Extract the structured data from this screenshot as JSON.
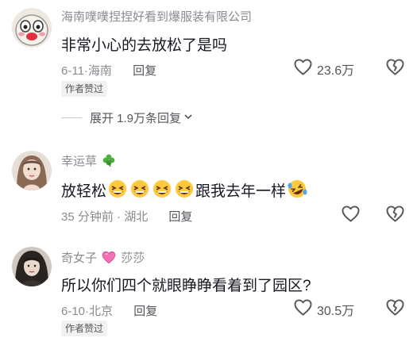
{
  "comments": [
    {
      "username": "海南噗噗捏捏好看到爆服装有限公司",
      "text": "非常小心的去放松了是吗",
      "date": "6-11",
      "location": "海南",
      "reply_label": "回复",
      "likes": "23.6万",
      "badge": "作者赞过",
      "expand_label": "展开 1.9万条回复"
    },
    {
      "username": "幸运草",
      "text_prefix": "放轻松",
      "text_suffix": "跟我去年一样",
      "date": "35 分钟前",
      "location": "湖北",
      "reply_label": "回复"
    },
    {
      "username": "奇女子",
      "username_suffix": "莎莎",
      "text": "所以你们四个就眼睁睁看着到了园区?",
      "date": "6-10",
      "location": "北京",
      "reply_label": "回复",
      "likes": "30.5万",
      "badge": "作者赞过"
    }
  ],
  "icons": {
    "clover": "four-leaf-clover-icon",
    "heart": "heart-outline-icon",
    "broken_heart": "broken-heart-icon",
    "pink_heart": "pink-heart-icon",
    "chevron": "chevron-down-icon"
  }
}
